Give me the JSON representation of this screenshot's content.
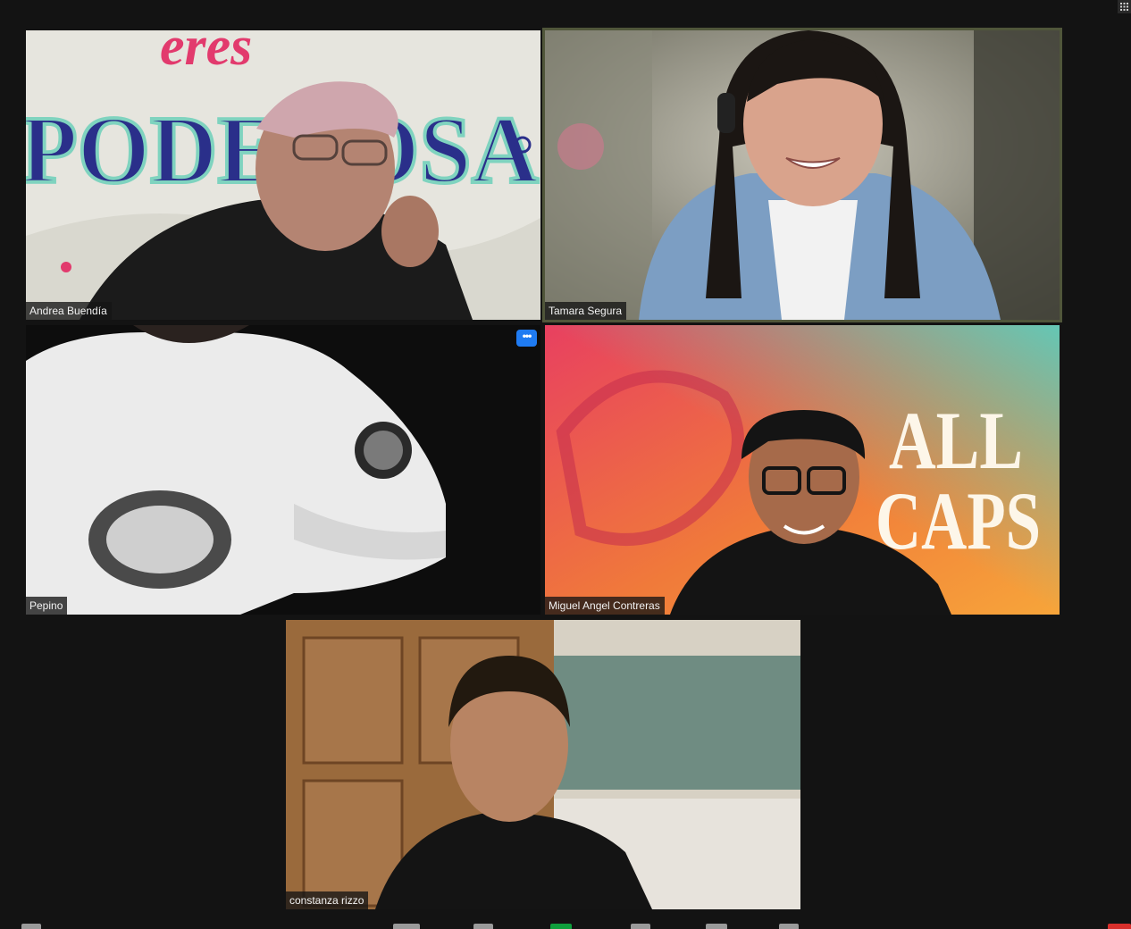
{
  "window": {
    "grid_view_icon": "grid-icon"
  },
  "participants": [
    {
      "name": "Andrea Buendía",
      "wall_text": [
        "eres",
        "PODEROSA"
      ]
    },
    {
      "name": "Tamara Segura",
      "active_speaker": true
    },
    {
      "name": "Pepino",
      "menu_label": "•••"
    },
    {
      "name": "Miguel Angel Contreras",
      "background_text": [
        "ALL",
        "CAPS"
      ]
    },
    {
      "name": "constanza rizzo"
    }
  ],
  "toolbar": {
    "icons": [
      "video-icon",
      "participants-icon",
      "chat-icon",
      "share-screen-icon",
      "record-icon",
      "reactions-icon",
      "apps-icon",
      "end-icon"
    ],
    "share_color": "#0e9f3c",
    "end_color": "#d9302c"
  },
  "colors": {
    "active_border": "#50563a",
    "more_button": "#1f7bf2"
  }
}
